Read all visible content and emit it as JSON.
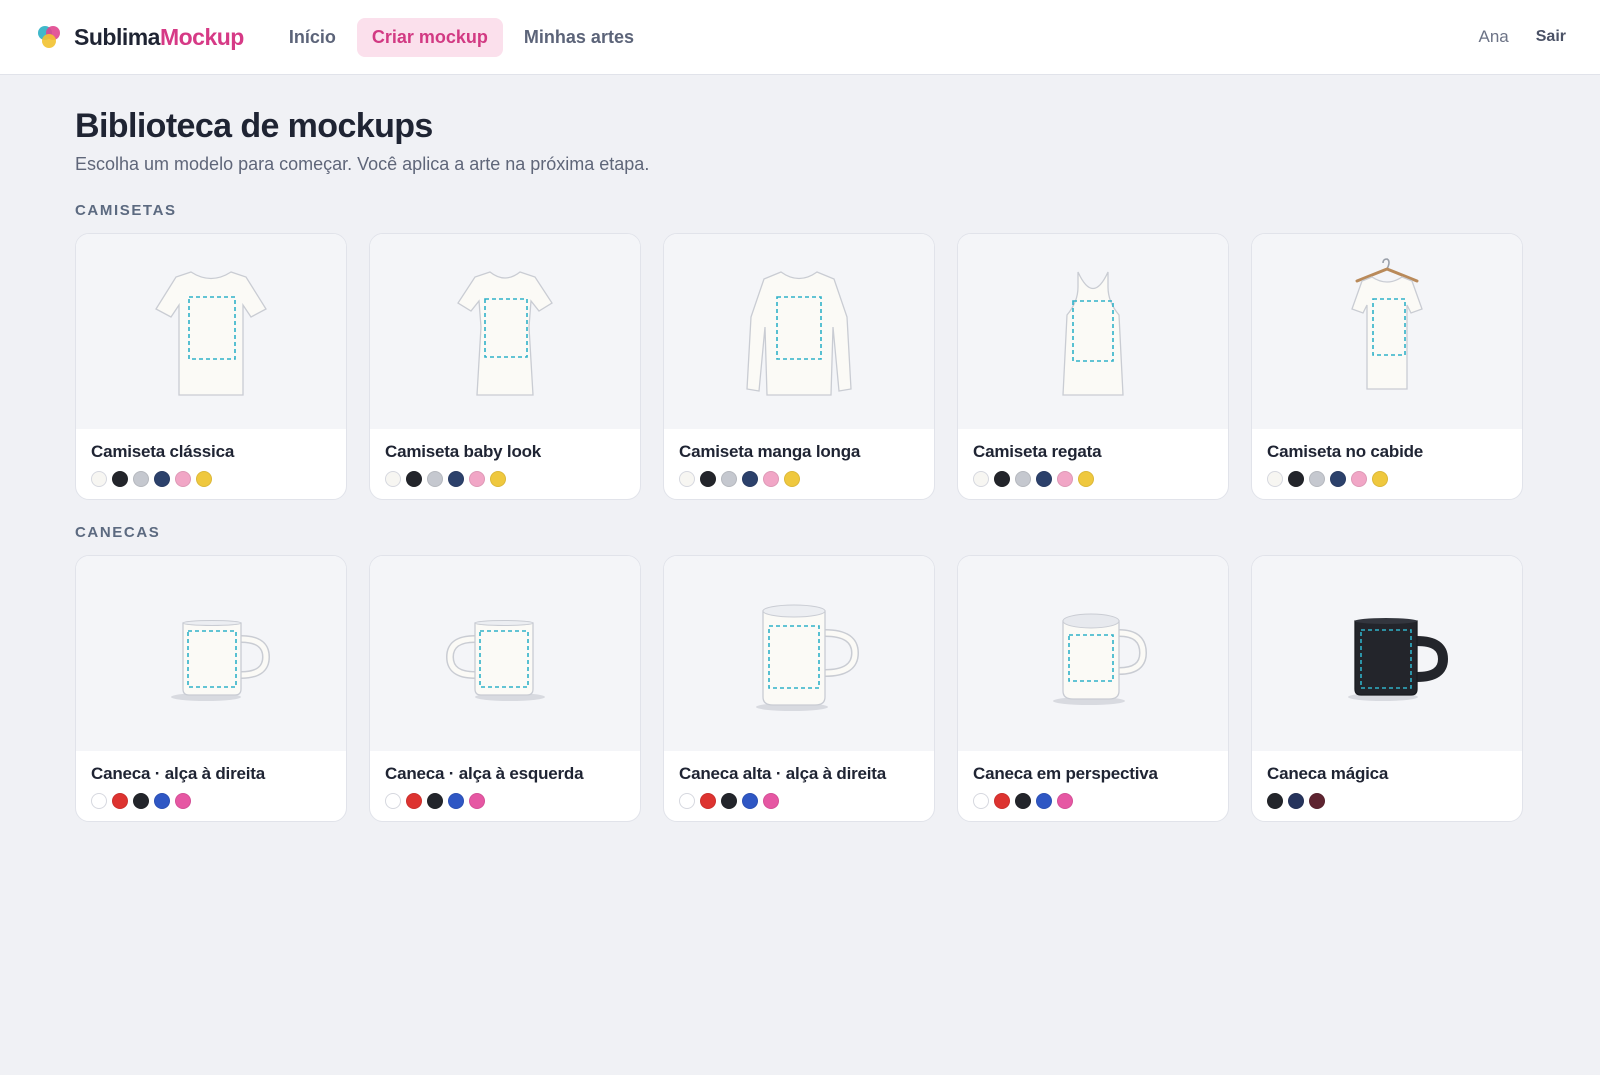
{
  "brand": {
    "name_part1": "Sublima",
    "name_part2": "Mockup"
  },
  "nav": {
    "items": [
      {
        "label": "Início",
        "active": false
      },
      {
        "label": "Criar mockup",
        "active": true
      },
      {
        "label": "Minhas artes",
        "active": false
      }
    ]
  },
  "user": {
    "name": "Ana",
    "logout_label": "Sair"
  },
  "page": {
    "title": "Biblioteca de mockups",
    "subtitle": "Escolha um modelo para começar. Você aplica a arte na próxima etapa."
  },
  "sections": [
    {
      "label": "CAMISETAS",
      "items": [
        {
          "title": "Camiseta clássica",
          "icon": "tshirt-classic-icon",
          "colors": [
            "#f7f6f2",
            "#23252b",
            "#c5c8cf",
            "#2c416b",
            "#f1a6c6",
            "#efc83e"
          ]
        },
        {
          "title": "Camiseta baby look",
          "icon": "tshirt-babylook-icon",
          "colors": [
            "#f7f6f2",
            "#23252b",
            "#c5c8cf",
            "#2c416b",
            "#f1a6c6",
            "#efc83e"
          ]
        },
        {
          "title": "Camiseta manga longa",
          "icon": "tshirt-longsleeve-icon",
          "colors": [
            "#f7f6f2",
            "#23252b",
            "#c5c8cf",
            "#2c416b",
            "#f1a6c6",
            "#efc83e"
          ]
        },
        {
          "title": "Camiseta regata",
          "icon": "tanktop-icon",
          "colors": [
            "#f7f6f2",
            "#23252b",
            "#c5c8cf",
            "#2c416b",
            "#f1a6c6",
            "#efc83e"
          ]
        },
        {
          "title": "Camiseta no cabide",
          "icon": "tshirt-hanger-icon",
          "colors": [
            "#f7f6f2",
            "#23252b",
            "#c5c8cf",
            "#2c416b",
            "#f1a6c6",
            "#efc83e"
          ]
        }
      ]
    },
    {
      "label": "CANECAS",
      "items": [
        {
          "title": "Caneca · alça à direita",
          "icon": "mug-right-handle-icon",
          "colors": [
            "#ffffff",
            "#dd3330",
            "#23252b",
            "#2f57c4",
            "#e657a3"
          ]
        },
        {
          "title": "Caneca · alça à esquerda",
          "icon": "mug-left-handle-icon",
          "colors": [
            "#ffffff",
            "#dd3330",
            "#23252b",
            "#2f57c4",
            "#e657a3"
          ]
        },
        {
          "title": "Caneca alta · alça à direita",
          "icon": "mug-tall-icon",
          "colors": [
            "#ffffff",
            "#dd3330",
            "#23252b",
            "#2f57c4",
            "#e657a3"
          ]
        },
        {
          "title": "Caneca em perspectiva",
          "icon": "mug-perspective-icon",
          "colors": [
            "#ffffff",
            "#dd3330",
            "#23252b",
            "#2f57c4",
            "#e657a3"
          ]
        },
        {
          "title": "Caneca mágica",
          "icon": "mug-magic-icon",
          "colors": [
            "#23252b",
            "#26345c",
            "#5e2430"
          ]
        }
      ]
    }
  ],
  "colors": {
    "accent": "#d63a86",
    "accent_bg": "#fbe0ec",
    "print_area": "#2fb1c8"
  }
}
